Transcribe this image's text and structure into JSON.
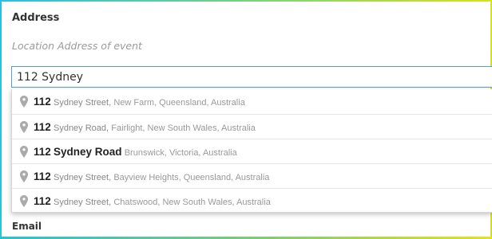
{
  "form": {
    "section_title": "Address",
    "section_hint": "Location Address of event",
    "address_input_value": "112 Sydney",
    "next_section_label": "Email"
  },
  "suggestions": [
    {
      "number": "112",
      "street": "Sydney Street,",
      "locality": "New Farm, Queensland, Australia"
    },
    {
      "number": "112",
      "street": "Sydney Road,",
      "locality": "Fairlight, New South Wales, Australia"
    },
    {
      "number": "112",
      "street": "Sydney Road",
      "locality": "Brunswick, Victoria, Australia"
    },
    {
      "number": "112",
      "street": "Sydney Street,",
      "locality": "Bayview Heights, Queensland, Australia"
    },
    {
      "number": "112",
      "street": "Sydney Street,",
      "locality": "Chatswood, New South Wales, Australia"
    }
  ],
  "icons": {
    "suggestion_icon": "map-pin-icon"
  },
  "colors": {
    "input_focus_border": "#5b9bd5",
    "frame_accent_start": "#2bbfe0",
    "frame_accent_end": "#d6e21c"
  }
}
